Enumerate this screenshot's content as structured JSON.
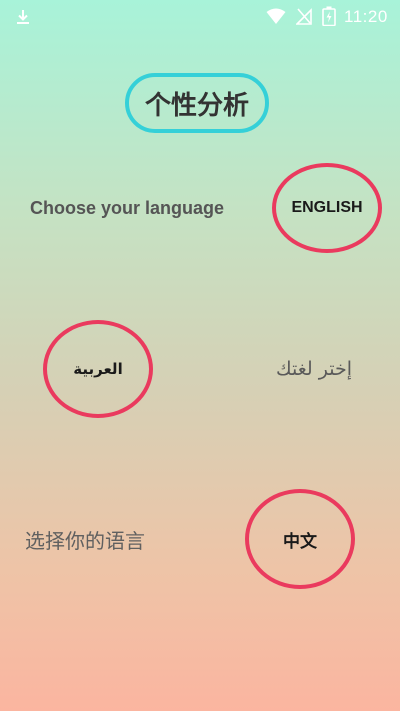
{
  "status_bar": {
    "time": "11:20",
    "icons": [
      "download-icon",
      "wifi-icon",
      "no-signal-icon",
      "battery-charging-icon"
    ]
  },
  "title": "个性分析",
  "prompts": {
    "english": "Choose your language",
    "arabic": "إختر لغتك",
    "chinese": "选择你的语言"
  },
  "buttons": {
    "english": "ENGLISH",
    "arabic": "العربية",
    "chinese": "中文"
  },
  "colors": {
    "title_border": "#35d0d8",
    "button_ring": "#ea3a5e",
    "gradient_top": "#a8f3d9",
    "gradient_bottom": "#fbb5a0"
  }
}
